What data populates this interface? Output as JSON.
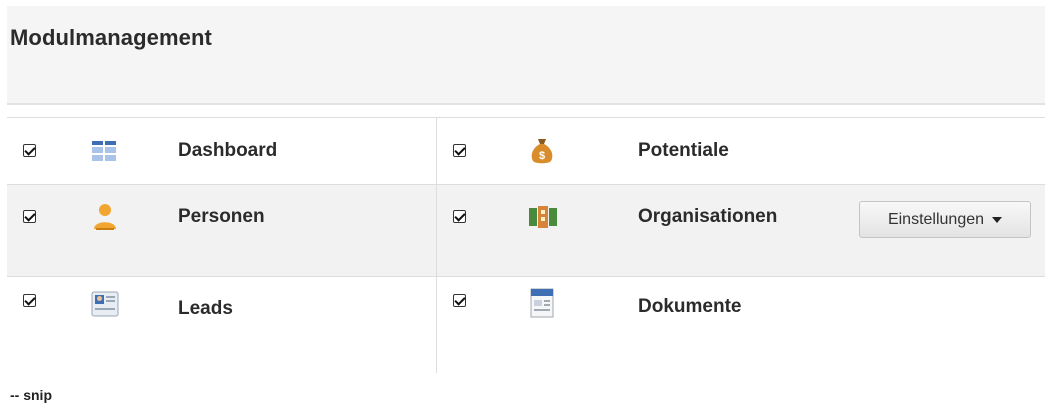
{
  "page_title": "Modulmanagement",
  "modules": [
    {
      "name": "Dashboard",
      "checked": true,
      "icon": "dashboard-grid-icon"
    },
    {
      "name": "Potentiale",
      "checked": true,
      "icon": "money-bag-icon"
    },
    {
      "name": "Personen",
      "checked": true,
      "icon": "person-icon"
    },
    {
      "name": "Organisationen",
      "checked": true,
      "icon": "organization-icon"
    },
    {
      "name": "Leads",
      "checked": true,
      "icon": "contact-card-icon"
    },
    {
      "name": "Dokumente",
      "checked": true,
      "icon": "document-icon"
    }
  ],
  "settings_button": {
    "label": "Einstellungen"
  },
  "footer_note": "-- snip",
  "colors": {
    "header_bg": "#f5f5f5",
    "row_alt_bg": "#f2f2f2",
    "border": "#dddddd",
    "icon_orange": "#f0a630",
    "icon_blue": "#3e6fb5"
  }
}
